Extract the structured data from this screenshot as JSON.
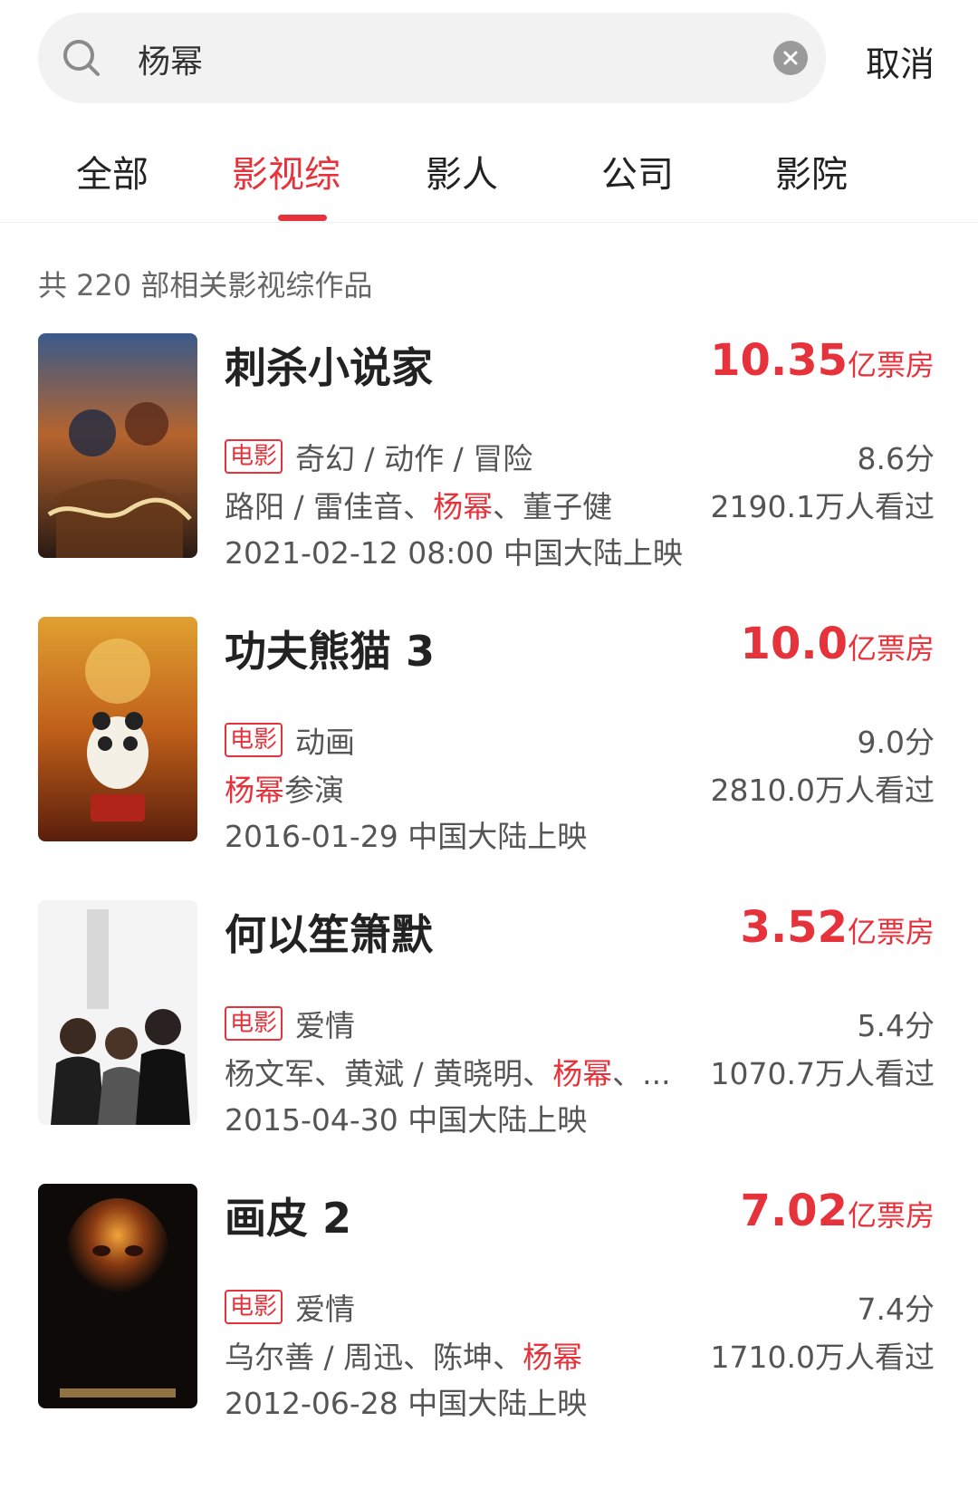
{
  "search": {
    "query": "杨幂",
    "cancel_label": "取消"
  },
  "tabs": [
    {
      "label": "全部"
    },
    {
      "label": "影视综"
    },
    {
      "label": "影人"
    },
    {
      "label": "公司"
    },
    {
      "label": "影院"
    }
  ],
  "active_tab": "影视综",
  "result_count_text": "共 220 部相关影视综作品",
  "colors": {
    "accent": "#e5323b"
  },
  "items": [
    {
      "title": "刺杀小说家",
      "box_office_value": "10.35",
      "box_office_unit": "亿票房",
      "tag": "电影",
      "genres": "奇幻 / 动作 / 冒险",
      "cast_before": "路阳 / 雷佳音、",
      "cast_highlight": "杨幂",
      "cast_after": "、董子健",
      "release": "2021-02-12 08:00 中国大陆上映",
      "score": "8.6分",
      "viewers": "2190.1万人看过"
    },
    {
      "title": "功夫熊猫 3",
      "box_office_value": "10.0",
      "box_office_unit": "亿票房",
      "tag": "电影",
      "genres": "动画",
      "cast_before": "",
      "cast_highlight": "杨幂",
      "cast_after": "参演",
      "release": "2016-01-29 中国大陆上映",
      "score": "9.0分",
      "viewers": "2810.0万人看过"
    },
    {
      "title": "何以笙箫默",
      "box_office_value": "3.52",
      "box_office_unit": "亿票房",
      "tag": "电影",
      "genres": "爱情",
      "cast_before": "杨文军、黄斌 / 黄晓明、",
      "cast_highlight": "杨幂",
      "cast_after": "、...",
      "release": "2015-04-30 中国大陆上映",
      "score": "5.4分",
      "viewers": "1070.7万人看过"
    },
    {
      "title": "画皮 2",
      "box_office_value": "7.02",
      "box_office_unit": "亿票房",
      "tag": "电影",
      "genres": "爱情",
      "cast_before": "乌尔善 / 周迅、陈坤、",
      "cast_highlight": "杨幂",
      "cast_after": "",
      "release": "2012-06-28 中国大陆上映",
      "score": "7.4分",
      "viewers": "1710.0万人看过"
    }
  ],
  "posters": [
    {
      "icon": "movie-poster-action"
    },
    {
      "icon": "movie-poster-animation"
    },
    {
      "icon": "movie-poster-romance"
    },
    {
      "icon": "movie-poster-dark"
    }
  ]
}
